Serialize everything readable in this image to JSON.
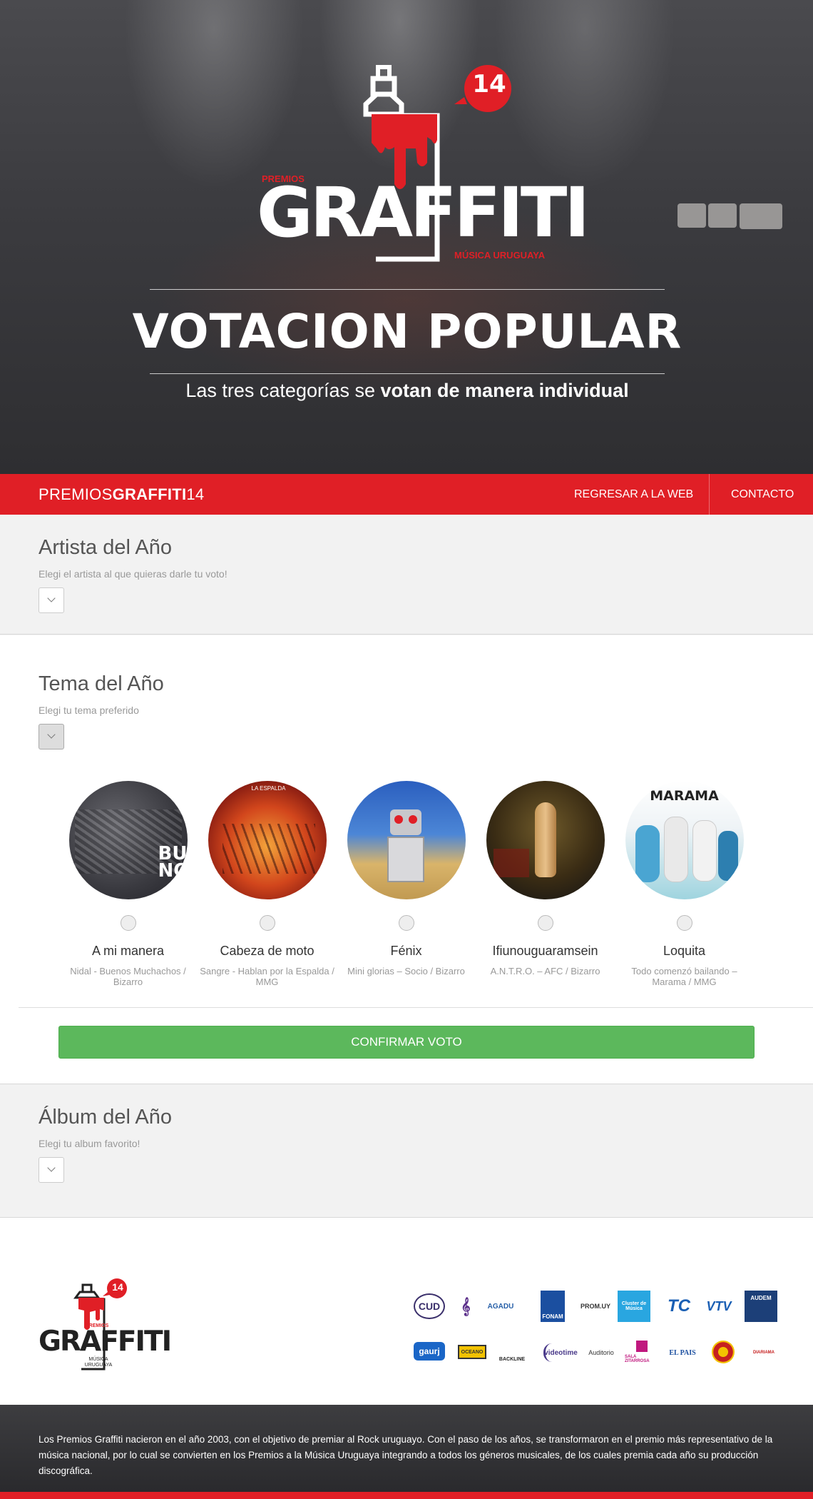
{
  "hero": {
    "logo": {
      "premios": "PREMIOS",
      "name": "GRAFFITI",
      "edition": "14",
      "tagline": "MÚSICA URUGUAYA"
    },
    "title": "VOTACION POPULAR",
    "subtitle_plain": "Las tres categorías se",
    "subtitle_bold": "votan de manera individual"
  },
  "nav": {
    "brand_plain": "PREMIOS",
    "brand_bold": "GRAFFITI",
    "brand_num": "14",
    "links": [
      "REGRESAR A LA WEB",
      "CONTACTO"
    ]
  },
  "sections": {
    "artista": {
      "title": "Artista del Año",
      "help": "Elegi el artista al que quieras darle tu voto!"
    },
    "tema": {
      "title": "Tema del Año",
      "help": "Elegi tu tema preferido"
    },
    "album": {
      "title": "Álbum del Año",
      "help": "Elegi tu album favorito!"
    }
  },
  "candidates": [
    {
      "name": "A mi manera",
      "desc": "Nidal - Buenos Muchachos / Bizarro",
      "cover_text": "BUE NOS"
    },
    {
      "name": "Cabeza de moto",
      "desc": "Sangre - Hablan por la Espalda / MMG",
      "cover_text": "LA ESPALDA"
    },
    {
      "name": "Fénix",
      "desc": "Mini glorias – Socio / Bizarro",
      "cover_text": ""
    },
    {
      "name": "Ifiunouguaramsein",
      "desc": "A.N.T.R.O. – AFC / Bizarro",
      "cover_text": ""
    },
    {
      "name": "Loquita",
      "desc": "Todo comenzó bailando – Marama / MMG",
      "cover_text": "MARAMA"
    }
  ],
  "confirm_label": "CONFIRMAR VOTO",
  "footer": {
    "logo": {
      "name": "GRAFFITI",
      "edition": "14",
      "premios": "PREMIOS",
      "tagline": "MÚSICA URUGUAYA"
    },
    "sponsors": [
      "CUD",
      "AGADU",
      "FONAM",
      "PROM.UY",
      "Cluster de Música",
      "TC",
      "VTV",
      "AUDEM",
      "gaurj",
      "OCEANO",
      "BACKLINE",
      "videotime",
      "Auditorio",
      "SALA ZITARROSA",
      "EL PAIS",
      "",
      "DIARIAMA"
    ],
    "about": "Los Premios Graffiti nacieron en el año 2003, con el objetivo de premiar al Rock uruguayo. Con el paso de los años, se transformaron en el premio más representativo de la música nacional, por lo cual se convierten en los Premios a la Música Uruguaya integrando a todos los géneros musicales, de los cuales premia cada año su producción discográfica."
  },
  "colors": {
    "brand_red": "#e01f26",
    "confirm_green": "#5cb85c",
    "section_grey": "#f2f2f2"
  }
}
